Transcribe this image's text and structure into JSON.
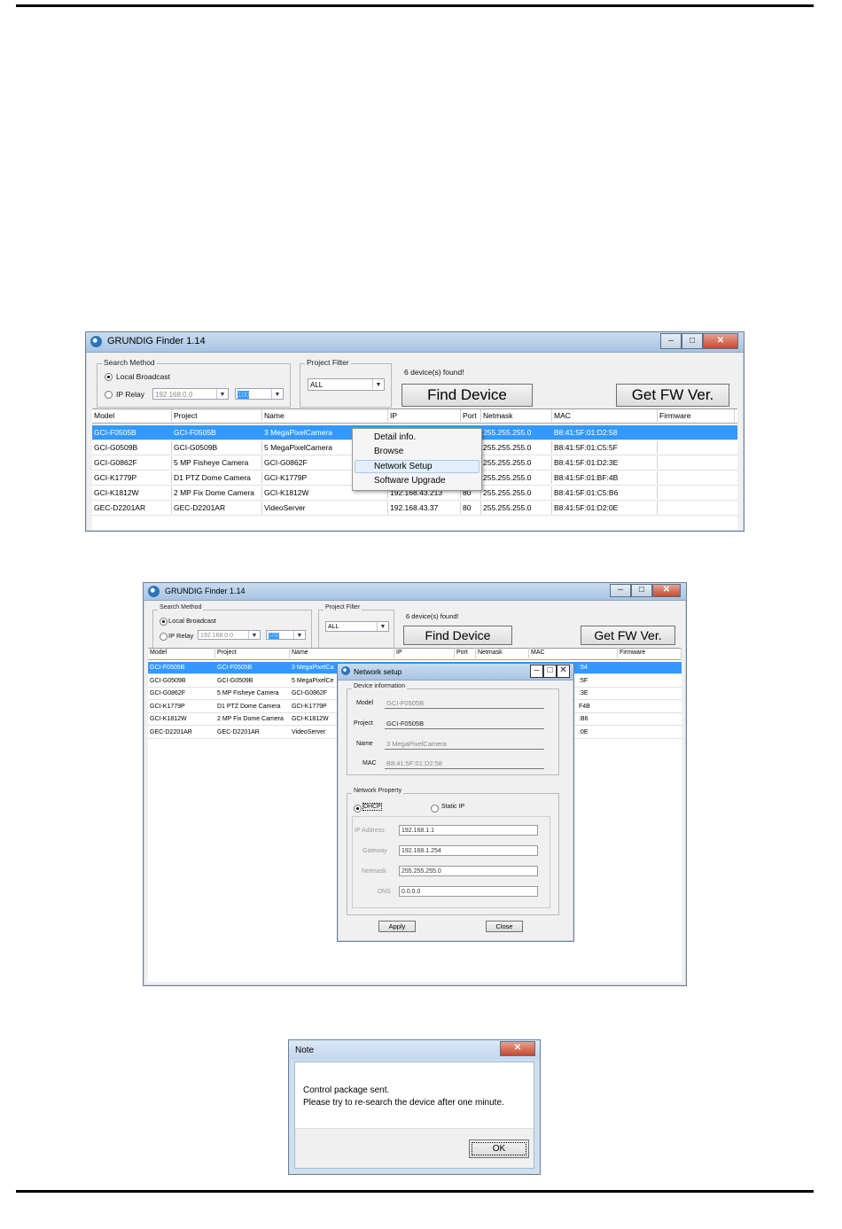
{
  "win1": {
    "title": "GRUNDIG Finder 1.14",
    "search_method": "Search Method",
    "local_broadcast": "Local Broadcast",
    "ip_relay": "IP Relay",
    "ip_value": "192.168.0.0",
    "port_value": "100",
    "project_filter": "Project Filter",
    "filter_value": "ALL",
    "status": "6 device(s) found!",
    "find_device": "Find Device",
    "get_fw": "Get FW Ver.",
    "columns": [
      "Model",
      "Project",
      "Name",
      "IP",
      "Port",
      "Netmask",
      "MAC",
      "Firmware"
    ],
    "rows": [
      [
        "GCI-F0505B",
        "GCI-F0505B",
        "3 MegaPixelCamera",
        "",
        "",
        "255.255.255.0",
        "B8:41:5F:01:D2:58",
        ""
      ],
      [
        "GCI-G0509B",
        "GCI-G0509B",
        "5 MegaPixelCamera",
        "",
        "",
        "255.255.255.0",
        "B8:41:5F:01:C5:5F",
        ""
      ],
      [
        "GCI-G0862F",
        "5 MP Fisheye Camera",
        "GCI-G0862F",
        "",
        "",
        "255.255.255.0",
        "B8:41:5F:01:D2:3E",
        ""
      ],
      [
        "GCI-K1779P",
        "D1 PTZ Dome Camera",
        "GCI-K1779P",
        "",
        "",
        "255.255.255.0",
        "B8:41:5F:01:BF:4B",
        ""
      ],
      [
        "GCI-K1812W",
        "2 MP Fix Dome Camera",
        "GCI-K1812W",
        "192.168.43.213",
        "80",
        "255.255.255.0",
        "B8:41:5F:01:C5:B6",
        ""
      ],
      [
        "GEC-D2201AR",
        "GEC-D2201AR",
        "VideoServer",
        "192.168.43.37",
        "80",
        "255.255.255.0",
        "B8:41:5F:01:D2:0E",
        ""
      ]
    ],
    "context_menu": [
      "Detail info.",
      "Browse",
      "Network Setup",
      "Software Upgrade"
    ]
  },
  "win2": {
    "title": "GRUNDIG Finder 1.14",
    "search_method": "Search Method",
    "local_broadcast": "Local Broadcast",
    "ip_relay": "IP Relay",
    "ip_value": "192.168.0.0",
    "port_value": "100",
    "project_filter": "Project Filter",
    "filter_value": "ALL",
    "status": "6 device(s) found!",
    "find_device": "Find Device",
    "get_fw": "Get FW Ver.",
    "columns": [
      "Model",
      "Project",
      "Name",
      "IP",
      "Port",
      "Netmask",
      "MAC",
      "Firmware"
    ],
    "rows": [
      [
        "GCI-F0505B",
        "GCI-F0505B",
        "3 MegaPixelCa",
        ":54"
      ],
      [
        "GCI-G0509B",
        "GCI-G0509B",
        "5 MegaPixelCe",
        ":5F"
      ],
      [
        "GCI-G0862F",
        "5 MP Fisheye Camera",
        "GCI-G0862F",
        ":3E"
      ],
      [
        "GCI-K1779P",
        "D1 PTZ Dome Camera",
        "GCI-K1779P",
        "F4B"
      ],
      [
        "GCI-K1812W",
        "2 MP Fix Dome Camera",
        "GCI-K1812W",
        ":B6"
      ],
      [
        "GEC-D2201AR",
        "GEC-D2201AR",
        "VideoServer",
        ":0E"
      ]
    ]
  },
  "netsetup": {
    "title": "Network setup",
    "device_info": "Device information",
    "model_label": "Model",
    "model_value": "GCI-F0505B",
    "project_label": "Project",
    "project_value": "GCI-F0505B",
    "name_label": "Name",
    "name_value": "3 MegaPixelCamera",
    "mac_label": "MAC",
    "mac_value": "B8:41:5F:01:D2:58",
    "network_property": "Network Property",
    "dhcp": "DHCP",
    "static_ip": "Static IP",
    "ip_label": "IP Address",
    "ip_value": "192.168.1.1",
    "gateway_label": "Gateway",
    "gateway_value": "192.168.1.254",
    "netmask_label": "Netmask",
    "netmask_value": "255.255.255.0",
    "dns_label": "DNS",
    "dns_value": "0.0.0.0",
    "apply": "Apply",
    "close": "Close"
  },
  "note": {
    "title": "Note",
    "line1": "Control package sent.",
    "line2": "Please try to re-search the device after one minute.",
    "ok": "OK"
  }
}
